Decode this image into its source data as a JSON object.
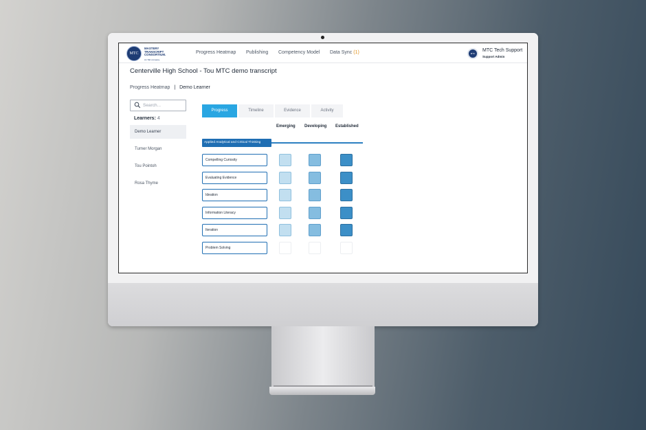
{
  "brand": {
    "seal_text": "MTC",
    "name_lines": [
      "MASTERY",
      "TRANSCRIPT",
      "CONSORTIUM."
    ],
    "tagline": "An Tab company"
  },
  "nav": {
    "items": [
      "Progress Heatmap",
      "Publishing",
      "Competency Model",
      "Data Sync"
    ],
    "data_sync_count": "(1)"
  },
  "user": {
    "avatar_text": "MTC",
    "name": "MTC Tech Support",
    "role": "Support Admin"
  },
  "page": {
    "title": "Centerville High School - Tou MTC demo transcript"
  },
  "breadcrumb": {
    "parent": "Progress Heatmap",
    "separator": "|",
    "current": "Demo Learner"
  },
  "search": {
    "placeholder": "Search..."
  },
  "learners": {
    "label": "Learners:",
    "count": "4",
    "items": [
      "Demo Learner",
      "Turner Morgan",
      "Tou Pointoh",
      "Rosa Thyme"
    ],
    "selected_index": 0
  },
  "tabs": {
    "items": [
      "Progress",
      "Timeline",
      "Evidence",
      "Activity"
    ],
    "active_index": 0
  },
  "heatmap": {
    "columns": [
      "Emerging",
      "Developing",
      "Established"
    ],
    "section": "Applied Analytical and Critical Thinking",
    "rows": [
      {
        "label": "Compelling Curiosity",
        "levels": [
          "filled",
          "filled",
          "filled"
        ]
      },
      {
        "label": "Evaluating Evidence",
        "levels": [
          "filled",
          "filled",
          "filled"
        ]
      },
      {
        "label": "Ideation",
        "levels": [
          "filled",
          "filled",
          "filled"
        ]
      },
      {
        "label": "Information Literacy",
        "levels": [
          "filled",
          "filled",
          "filled"
        ]
      },
      {
        "label": "Iteration",
        "levels": [
          "filled",
          "filled",
          "filled"
        ]
      },
      {
        "label": "Problem Solving",
        "levels": [
          "empty",
          "empty",
          "empty"
        ]
      }
    ],
    "colors": {
      "emerging": "#c2dff0",
      "developing": "#85bde0",
      "established": "#3c8fc7",
      "accent": "#29a6e2",
      "section": "#1f6eb3"
    }
  }
}
